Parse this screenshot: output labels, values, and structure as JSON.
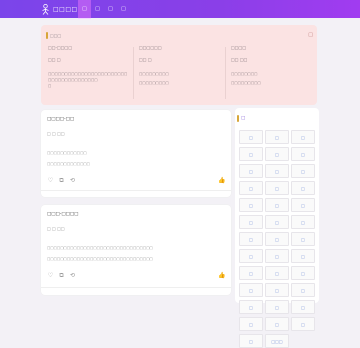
{
  "header": {
    "logo_text": "□□□□□",
    "nav": [
      "□",
      "□",
      "□",
      "□"
    ]
  },
  "notice": {
    "title": "□□□",
    "close": "□",
    "columns": [
      {
        "head": "□□-□□□□",
        "sub": "□□ □",
        "lines": [
          "□□□□□□□□□□□□□□□□□□□□□□□□□□□□□□□□□□□□□□□",
          "□"
        ]
      },
      {
        "head": "□□□□□□",
        "sub": "□□ □",
        "lines": [
          "□□□□□□□□□",
          "□□□□□□□□□"
        ]
      },
      {
        "head": "□□□□",
        "sub": "□□ □□",
        "lines": [
          "□□□□□□□□",
          "□□□□□□□□□"
        ]
      }
    ]
  },
  "posts": [
    {
      "title": "□□□□-□□",
      "meta": "□ □ □□",
      "lines": [
        "□□□□□□□□□□□□",
        "□□□□□□□□□□□□□"
      ]
    },
    {
      "title": "□□□-□□□□",
      "meta": "□ □ □□",
      "lines": [
        "□□□□□□□□□□□□□□□□□□□□□□□□□□□□□□□□",
        "□□□□□□□□□□□□□□□□□□□□□□□□□□□□□□□□"
      ]
    }
  ],
  "side": {
    "title": "□",
    "tags": [
      "□",
      "□",
      "□",
      "□",
      "□",
      "□",
      "□",
      "□",
      "□",
      "□",
      "□",
      "□",
      "□",
      "□",
      "□",
      "□",
      "□",
      "□",
      "□",
      "□",
      "□",
      "□",
      "□",
      "□",
      "□",
      "□",
      "□",
      "□",
      "□",
      "□",
      "□",
      "□",
      "□",
      "□",
      "□",
      "□",
      "□",
      "□□□"
    ]
  }
}
